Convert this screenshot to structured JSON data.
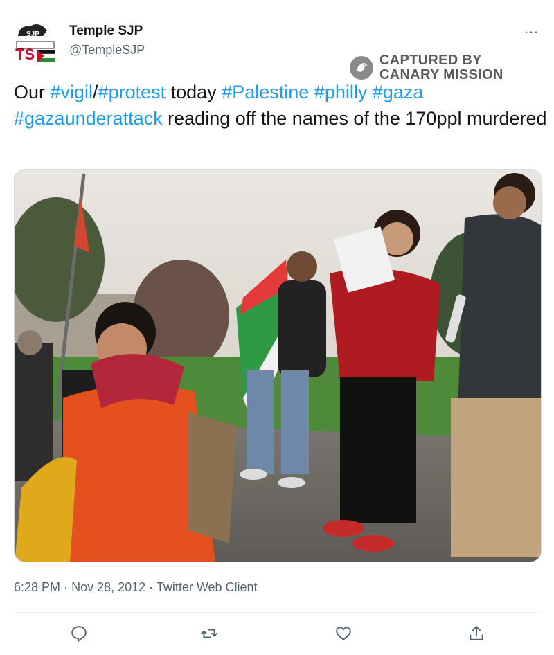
{
  "tweet": {
    "display_name": "Temple SJP",
    "handle": "@TempleSJP",
    "more_icon": "…",
    "text_parts": [
      {
        "text": "Our ",
        "tag": false
      },
      {
        "text": "#vigil",
        "tag": true
      },
      {
        "text": "/",
        "tag": false
      },
      {
        "text": "#protest",
        "tag": true
      },
      {
        "text": " today ",
        "tag": false
      },
      {
        "text": "#Palestine",
        "tag": true
      },
      {
        "text": " ",
        "tag": false
      },
      {
        "text": "#philly",
        "tag": true
      },
      {
        "text": " ",
        "tag": false
      },
      {
        "text": "#gaza",
        "tag": true
      },
      {
        "text": " ",
        "tag": false
      },
      {
        "text": "#gazaunderattack",
        "tag": true
      },
      {
        "text": " reading off the names of the 170ppl murdered",
        "tag": false
      }
    ],
    "time": "6:28 PM",
    "separator": "·",
    "date": "Nov 28, 2012",
    "client": "Twitter Web Client"
  },
  "watermark": {
    "line1": "CAPTURED BY",
    "line2": "CANARY MISSION"
  },
  "avatar_text": {
    "top": "SJP",
    "bottom": "TS"
  },
  "colors": {
    "link": "#1d9bf0",
    "text": "#0f1419",
    "secondary": "#536471"
  },
  "actions": [
    {
      "name": "reply-icon"
    },
    {
      "name": "retweet-icon"
    },
    {
      "name": "like-icon"
    },
    {
      "name": "share-icon"
    }
  ]
}
